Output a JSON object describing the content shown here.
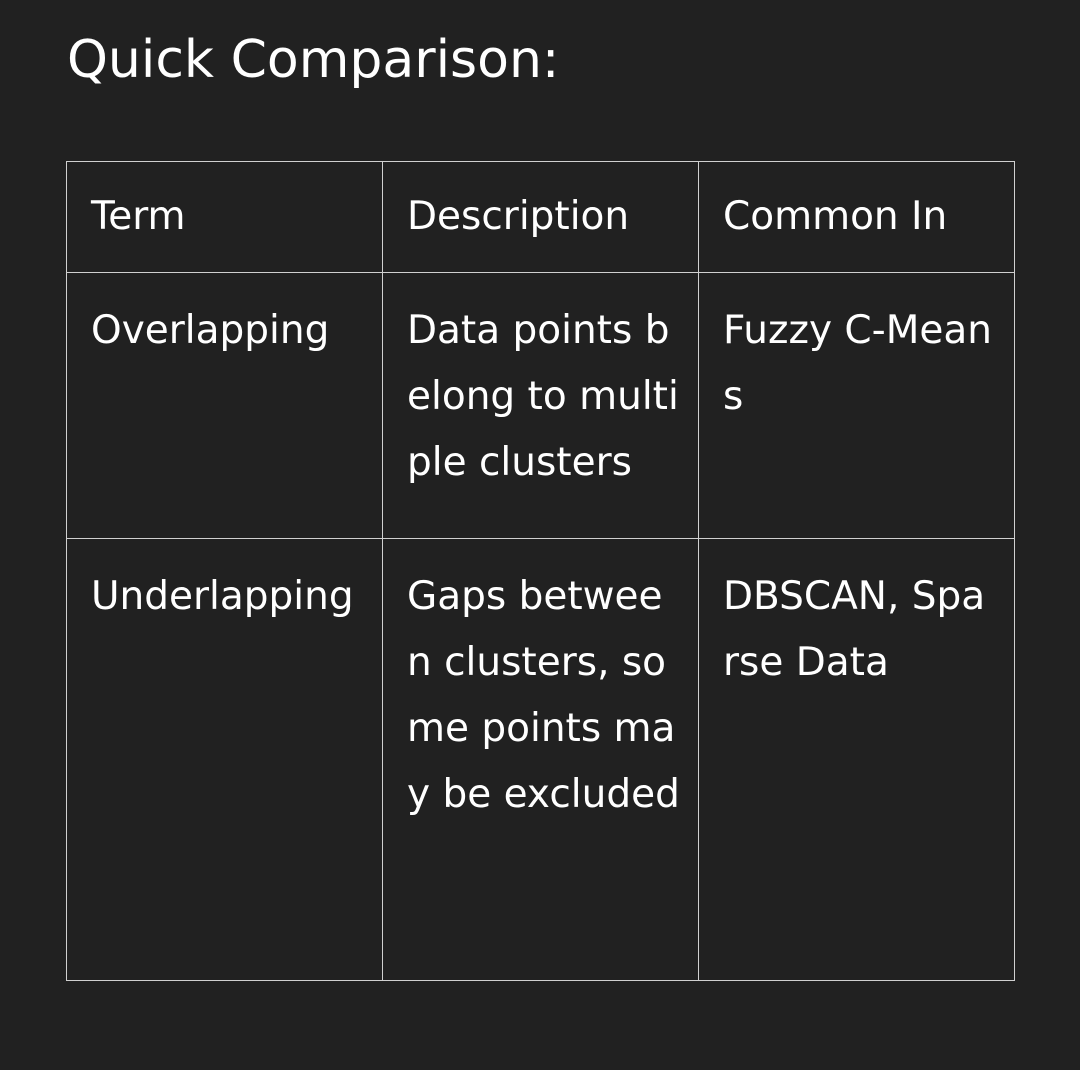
{
  "heading": "Quick Comparison:",
  "table": {
    "headers": [
      "Term",
      "Description",
      "Common In"
    ],
    "rows": [
      {
        "term": "Overlapping",
        "description": "Data points belong to multiple clusters",
        "common_in": "Fuzzy C-Means"
      },
      {
        "term": "Underlapping",
        "description": "Gaps between clusters, some points may be excluded",
        "common_in": "DBSCAN, Sparse Data"
      }
    ]
  }
}
